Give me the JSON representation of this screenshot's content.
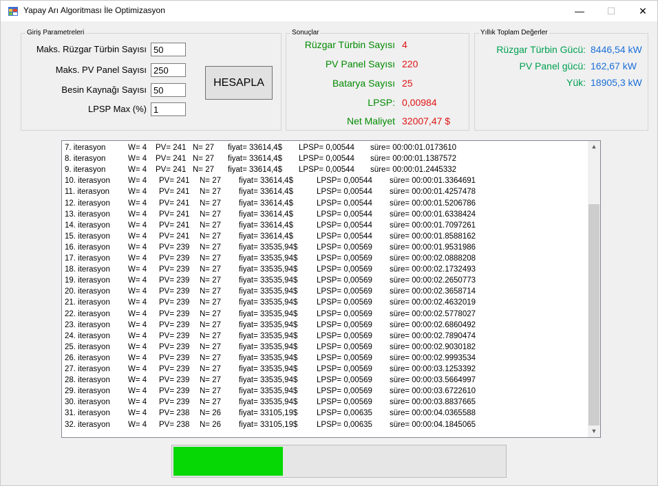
{
  "window": {
    "title": "Yapay Arı Algoritması İle Optimizasyon",
    "minimize": "—",
    "maximize": "☐",
    "close": "✕"
  },
  "inputs": {
    "legend": "Giriş Parametreleri",
    "fields": [
      {
        "label": "Maks. Rüzgar Türbin Sayısı",
        "value": "50"
      },
      {
        "label": "Maks. PV Panel Sayısı",
        "value": "250"
      },
      {
        "label": "Besin Kaynağı Sayısı",
        "value": "50"
      },
      {
        "label": "LPSP Max (%)",
        "value": "1"
      }
    ],
    "button": "HESAPLA"
  },
  "results": {
    "legend": "Sonuçlar",
    "rows": [
      {
        "label": "Rüzgar Türbin Sayısı",
        "value": "4"
      },
      {
        "label": "PV Panel Sayısı",
        "value": "220"
      },
      {
        "label": "Batarya Sayısı",
        "value": "25"
      },
      {
        "label": "LPSP:",
        "value": "0,00984"
      },
      {
        "label": "Net Maliyet",
        "value": "32007,47 $"
      }
    ]
  },
  "yearly": {
    "legend": "Yıllık Toplam Değerler",
    "rows": [
      {
        "label": "Rüzgar Türbin Gücü:",
        "value": "8446,54 kW"
      },
      {
        "label": "PV Panel gücü:",
        "value": "162,67 kW"
      },
      {
        "label": "Yük:",
        "value": "18905,3 kW"
      }
    ]
  },
  "log": [
    {
      "it": "7. iterasyon",
      "w": "W= 4",
      "pv": "PV= 241",
      "n": "N= 27",
      "fiyat": "fiyat= 33614,4$",
      "lpsp": "LPSP= 0,00544",
      "sure": "süre= 00:00:01.0173610"
    },
    {
      "it": "8. iterasyon",
      "w": "W= 4",
      "pv": "PV= 241",
      "n": "N= 27",
      "fiyat": "fiyat= 33614,4$",
      "lpsp": "LPSP= 0,00544",
      "sure": "süre= 00:00:01.1387572"
    },
    {
      "it": "9. iterasyon",
      "w": "W= 4",
      "pv": "PV= 241",
      "n": "N= 27",
      "fiyat": "fiyat= 33614,4$",
      "lpsp": "LPSP= 0,00544",
      "sure": "süre= 00:00:01.2445332"
    },
    {
      "it": "10. iterasyon",
      "w": "W= 4",
      "pv": "PV= 241",
      "n": "N= 27",
      "fiyat": "fiyat= 33614,4$",
      "lpsp": "LPSP= 0,00544",
      "sure": "süre= 00:00:01.3364691"
    },
    {
      "it": "11. iterasyon",
      "w": "W= 4",
      "pv": "PV= 241",
      "n": "N= 27",
      "fiyat": "fiyat= 33614,4$",
      "lpsp": "LPSP= 0,00544",
      "sure": "süre= 00:00:01.4257478"
    },
    {
      "it": "12. iterasyon",
      "w": "W= 4",
      "pv": "PV= 241",
      "n": "N= 27",
      "fiyat": "fiyat= 33614,4$",
      "lpsp": "LPSP= 0,00544",
      "sure": "süre= 00:00:01.5206786"
    },
    {
      "it": "13. iterasyon",
      "w": "W= 4",
      "pv": "PV= 241",
      "n": "N= 27",
      "fiyat": "fiyat= 33614,4$",
      "lpsp": "LPSP= 0,00544",
      "sure": "süre= 00:00:01.6338424"
    },
    {
      "it": "14. iterasyon",
      "w": "W= 4",
      "pv": "PV= 241",
      "n": "N= 27",
      "fiyat": "fiyat= 33614,4$",
      "lpsp": "LPSP= 0,00544",
      "sure": "süre= 00:00:01.7097261"
    },
    {
      "it": "15. iterasyon",
      "w": "W= 4",
      "pv": "PV= 241",
      "n": "N= 27",
      "fiyat": "fiyat= 33614,4$",
      "lpsp": "LPSP= 0,00544",
      "sure": "süre= 00:00:01.8588162"
    },
    {
      "it": "16. iterasyon",
      "w": "W= 4",
      "pv": "PV= 239",
      "n": "N= 27",
      "fiyat": "fiyat= 33535,94$",
      "lpsp": "LPSP= 0,00569",
      "sure": "süre= 00:00:01.9531986"
    },
    {
      "it": "17. iterasyon",
      "w": "W= 4",
      "pv": "PV= 239",
      "n": "N= 27",
      "fiyat": "fiyat= 33535,94$",
      "lpsp": "LPSP= 0,00569",
      "sure": "süre= 00:00:02.0888208"
    },
    {
      "it": "18. iterasyon",
      "w": "W= 4",
      "pv": "PV= 239",
      "n": "N= 27",
      "fiyat": "fiyat= 33535,94$",
      "lpsp": "LPSP= 0,00569",
      "sure": "süre= 00:00:02.1732493"
    },
    {
      "it": "19. iterasyon",
      "w": "W= 4",
      "pv": "PV= 239",
      "n": "N= 27",
      "fiyat": "fiyat= 33535,94$",
      "lpsp": "LPSP= 0,00569",
      "sure": "süre= 00:00:02.2650773"
    },
    {
      "it": "20. iterasyon",
      "w": "W= 4",
      "pv": "PV= 239",
      "n": "N= 27",
      "fiyat": "fiyat= 33535,94$",
      "lpsp": "LPSP= 0,00569",
      "sure": "süre= 00:00:02.3658714"
    },
    {
      "it": "21. iterasyon",
      "w": "W= 4",
      "pv": "PV= 239",
      "n": "N= 27",
      "fiyat": "fiyat= 33535,94$",
      "lpsp": "LPSP= 0,00569",
      "sure": "süre= 00:00:02.4632019"
    },
    {
      "it": "22. iterasyon",
      "w": "W= 4",
      "pv": "PV= 239",
      "n": "N= 27",
      "fiyat": "fiyat= 33535,94$",
      "lpsp": "LPSP= 0,00569",
      "sure": "süre= 00:00:02.5778027"
    },
    {
      "it": "23. iterasyon",
      "w": "W= 4",
      "pv": "PV= 239",
      "n": "N= 27",
      "fiyat": "fiyat= 33535,94$",
      "lpsp": "LPSP= 0,00569",
      "sure": "süre= 00:00:02.6860492"
    },
    {
      "it": "24. iterasyon",
      "w": "W= 4",
      "pv": "PV= 239",
      "n": "N= 27",
      "fiyat": "fiyat= 33535,94$",
      "lpsp": "LPSP= 0,00569",
      "sure": "süre= 00:00:02.7890474"
    },
    {
      "it": "25. iterasyon",
      "w": "W= 4",
      "pv": "PV= 239",
      "n": "N= 27",
      "fiyat": "fiyat= 33535,94$",
      "lpsp": "LPSP= 0,00569",
      "sure": "süre= 00:00:02.9030182"
    },
    {
      "it": "26. iterasyon",
      "w": "W= 4",
      "pv": "PV= 239",
      "n": "N= 27",
      "fiyat": "fiyat= 33535,94$",
      "lpsp": "LPSP= 0,00569",
      "sure": "süre= 00:00:02.9993534"
    },
    {
      "it": "27. iterasyon",
      "w": "W= 4",
      "pv": "PV= 239",
      "n": "N= 27",
      "fiyat": "fiyat= 33535,94$",
      "lpsp": "LPSP= 0,00569",
      "sure": "süre= 00:00:03.1253392"
    },
    {
      "it": "28. iterasyon",
      "w": "W= 4",
      "pv": "PV= 239",
      "n": "N= 27",
      "fiyat": "fiyat= 33535,94$",
      "lpsp": "LPSP= 0,00569",
      "sure": "süre= 00:00:03.5664997"
    },
    {
      "it": "29. iterasyon",
      "w": "W= 4",
      "pv": "PV= 239",
      "n": "N= 27",
      "fiyat": "fiyat= 33535,94$",
      "lpsp": "LPSP= 0,00569",
      "sure": "süre= 00:00:03.6722610"
    },
    {
      "it": "30. iterasyon",
      "w": "W= 4",
      "pv": "PV= 239",
      "n": "N= 27",
      "fiyat": "fiyat= 33535,94$",
      "lpsp": "LPSP= 0,00569",
      "sure": "süre= 00:00:03.8837665"
    },
    {
      "it": "31. iterasyon",
      "w": "W= 4",
      "pv": "PV= 238",
      "n": "N= 26",
      "fiyat": "fiyat= 33105,19$",
      "lpsp": "LPSP= 0,00635",
      "sure": "süre= 00:00:04.0365588"
    },
    {
      "it": "32. iterasyon",
      "w": "W= 4",
      "pv": "PV= 238",
      "n": "N= 26",
      "fiyat": "fiyat= 33105,19$",
      "lpsp": "LPSP= 0,00635",
      "sure": "süre= 00:00:04.1845065"
    }
  ],
  "progress": {
    "fraction": 0.33
  },
  "colors": {
    "progress": "#06d806",
    "result_label": "#008a00",
    "result_value": "#e01414",
    "yearly_label": "#00a050",
    "yearly_value": "#1a6ed8"
  },
  "icons": {
    "app": "app-window-icon",
    "scroll_up": "chevron-up-icon",
    "scroll_down": "chevron-down-icon"
  }
}
